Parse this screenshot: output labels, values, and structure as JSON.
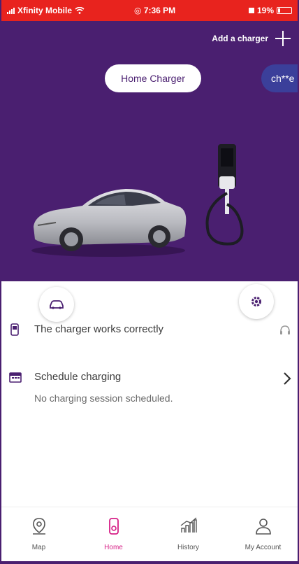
{
  "status_bar": {
    "carrier": "Xfinity Mobile",
    "time": "7:36 PM",
    "battery": "19%"
  },
  "header": {
    "add_charger_label": "Add a charger"
  },
  "chargers": {
    "selected": "Home Charger",
    "other": "ch**e"
  },
  "status": {
    "message": "The charger works correctly"
  },
  "schedule": {
    "title": "Schedule charging",
    "subtitle": "No charging session scheduled."
  },
  "nav": {
    "items": [
      {
        "label": "Map",
        "icon": "map-pin-icon"
      },
      {
        "label": "Home",
        "icon": "charger-icon"
      },
      {
        "label": "History",
        "icon": "chart-icon"
      },
      {
        "label": "My Account",
        "icon": "person-icon"
      }
    ],
    "active_index": 1
  },
  "colors": {
    "brand_purple": "#4a1f70",
    "status_bar_red": "#e8231e",
    "active_pink": "#d61f86",
    "secondary_pill": "#3b3f9a"
  }
}
